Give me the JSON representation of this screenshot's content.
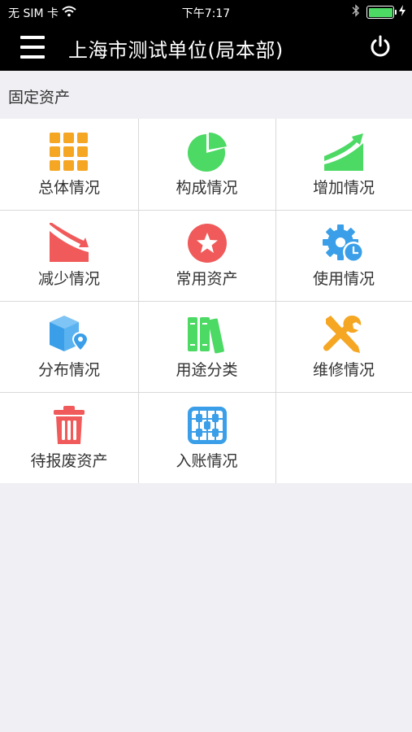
{
  "status_bar": {
    "carrier": "无 SIM 卡",
    "time": "下午7:17",
    "battery_color": "#4cd964"
  },
  "nav": {
    "title": "上海市测试单位(局本部)",
    "menu_icon": "hamburger-menu-icon",
    "power_icon": "power-icon"
  },
  "section": {
    "title": "固定资产"
  },
  "grid_items": [
    {
      "label": "总体情况",
      "icon": "grid-icon",
      "color": "#f5a623"
    },
    {
      "label": "构成情况",
      "icon": "pie-chart-icon",
      "color": "#4cd964"
    },
    {
      "label": "增加情况",
      "icon": "trend-up-icon",
      "color": "#4cd964"
    },
    {
      "label": "减少情况",
      "icon": "trend-down-icon",
      "color": "#f05a5a"
    },
    {
      "label": "常用资产",
      "icon": "star-icon",
      "color": "#f05a5a"
    },
    {
      "label": "使用情况",
      "icon": "gear-clock-icon",
      "color": "#3a9fe8"
    },
    {
      "label": "分布情况",
      "icon": "box-location-icon",
      "color": "#3a9fe8"
    },
    {
      "label": "用途分类",
      "icon": "books-icon",
      "color": "#4cd964"
    },
    {
      "label": "维修情况",
      "icon": "tools-icon",
      "color": "#f5a623"
    },
    {
      "label": "待报废资产",
      "icon": "trash-icon",
      "color": "#f05a5a"
    },
    {
      "label": "入账情况",
      "icon": "abacus-icon",
      "color": "#3a9fe8"
    }
  ]
}
